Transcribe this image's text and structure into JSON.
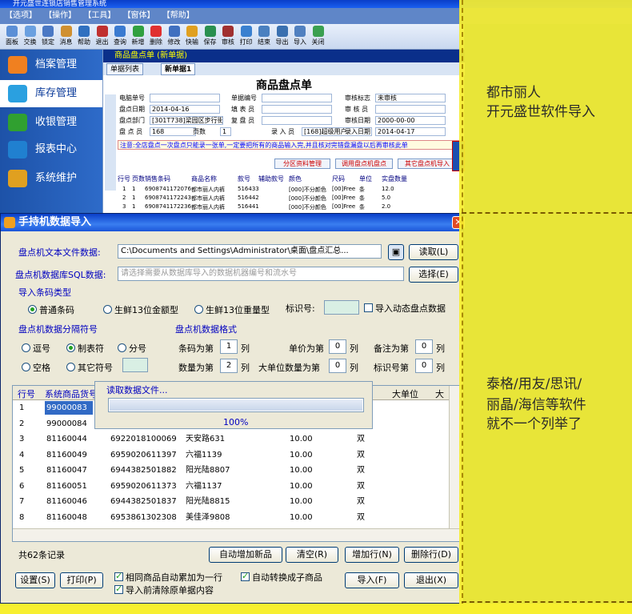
{
  "app": {
    "title": "开元盛世连锁店销售管理系统"
  },
  "menu": [
    "【选项】",
    "【操作】",
    "【工具】",
    "【窗体】",
    "【帮助】"
  ],
  "toolbar": [
    "面板",
    "交换",
    "锁定",
    "消息",
    "帮助",
    "退出",
    "查询",
    "新增",
    "删除",
    "修改",
    "快输",
    "保存",
    "审核",
    "打印",
    "结束",
    "导出",
    "导入",
    "关闭"
  ],
  "sidebar": [
    {
      "label": "档案管理",
      "color": "#f08020"
    },
    {
      "label": "库存管理",
      "color": "#2aa0e0"
    },
    {
      "label": "收银管理",
      "color": "#30a030"
    },
    {
      "label": "报表中心",
      "color": "#2080d0"
    },
    {
      "label": "系统维护",
      "color": "#e0a020"
    }
  ],
  "doc": {
    "header": "商品盘点单  (新单据)",
    "tabs": [
      "单据列表",
      "新单据1"
    ],
    "title": "商品盘点单",
    "fields": [
      {
        "label": "电脑单号",
        "value": ""
      },
      {
        "label": "单据编号",
        "value": ""
      },
      {
        "label": "审核标志",
        "value": "未审核"
      },
      {
        "label": "盘点日期",
        "value": "2014-04-16"
      },
      {
        "label": "填 表 员",
        "value": ""
      },
      {
        "label": "审 核 员",
        "value": ""
      },
      {
        "label": "盘点部门",
        "value": "[301T738]梁园区步行街店"
      },
      {
        "label": "复 盘 员",
        "value": ""
      },
      {
        "label": "审核日期",
        "value": "2000-00-00"
      },
      {
        "label": "盘 点 员",
        "value": "168"
      },
      {
        "label": "页数",
        "value": "1"
      },
      {
        "label": "录 入 员",
        "value": "[168]超级用户"
      },
      {
        "label": "录入日期",
        "value": "2014-04-17"
      }
    ],
    "notice": "注意:全店盘点一次盘点只能录一张单,一定要把所有的商品输入完,并且核对完错盘漏盘以后再审核此单",
    "buttons": [
      "分区资料管理",
      "调用盘点机盘点",
      "其它盘点机导入"
    ],
    "columns": [
      "行号",
      "页数",
      "销售条码",
      "商品名称",
      "款号",
      "辅助款号",
      "颜色",
      "尺码",
      "单位",
      "实盘数量"
    ],
    "rows": [
      [
        "1",
        "1",
        "6908741172076",
        "都市丽人内裤",
        "516433",
        "",
        "[000]不分颜色",
        "[00]Free",
        "条",
        "12.0"
      ],
      [
        "2",
        "1",
        "6908741172243",
        "都市丽人内裤",
        "516442",
        "",
        "[000]不分颜色",
        "[00]Free",
        "条",
        "5.0"
      ],
      [
        "3",
        "1",
        "6908741172236",
        "都市丽人内裤",
        "516441",
        "",
        "[000]不分颜色",
        "[00]Free",
        "条",
        "2.0"
      ]
    ]
  },
  "dialog": {
    "title": "手持机数据导入",
    "file_label": "盘点机文本文件数据:",
    "file_value": "C:\\Documents and Settings\\Administrator\\桌面\\盘点汇总...",
    "read_button": "读取(L)",
    "sql_label": "盘点机数据库SQL数据:",
    "sql_placeholder": "请选择需要从数据库导入的数据机器编号和流水号",
    "select_button": "选择(E)",
    "barcode_type_label": "导入条码类型",
    "barcode_types": [
      "普通条码",
      "生鲜13位金额型",
      "生鲜13位重量型"
    ],
    "marker_label": "标识号:",
    "dynamic_label": "导入动态盘点数据",
    "sep_label": "盘点机数据分隔符号",
    "seps": [
      "逗号",
      "制表符",
      "分号",
      "空格",
      "其它符号"
    ],
    "format_label": "盘点机数据格式",
    "format": {
      "barcode_col_label": "条码为第",
      "barcode_col": "1",
      "price_col_label": "单价为第",
      "price_col": "0",
      "note_col_label": "备注为第",
      "note_col": "0",
      "qty_col_label": "数量为第",
      "qty_col": "2",
      "bigunit_col_label": "大单位数量为第",
      "bigunit_col": "0",
      "marker_col_label": "标识号第",
      "marker_col": "0",
      "col_suffix": "列"
    },
    "grid_columns": [
      "行号",
      "系统商品货号",
      "",
      "",
      "",
      "大单位",
      "大"
    ],
    "grid_rows": [
      [
        "1",
        "99000083",
        "",
        "",
        "",
        ""
      ],
      [
        "2",
        "99000084",
        "",
        "",
        "",
        ""
      ],
      [
        "3",
        "81160044",
        "6922018100069",
        "天安路631",
        "10.00",
        "双"
      ],
      [
        "4",
        "81160049",
        "6959020611397",
        "六福1139",
        "10.00",
        "双"
      ],
      [
        "5",
        "81160047",
        "6944382501882",
        "阳光陆8807",
        "10.00",
        "双"
      ],
      [
        "6",
        "81160051",
        "6959020611373",
        "六福1137",
        "10.00",
        "双"
      ],
      [
        "7",
        "81160046",
        "6944382501837",
        "阳光陆8815",
        "10.00",
        "双"
      ],
      [
        "8",
        "81160048",
        "6953861302308",
        "美佳泽9808",
        "10.00",
        "双"
      ]
    ],
    "record_count": "共62条记录",
    "buttons": [
      "自动增加新品",
      "清空(R)",
      "增加行(N)",
      "删除行(D)"
    ],
    "bottom_buttons": [
      "设置(S)",
      "打印(P)",
      "导入(F)",
      "退出(X)"
    ],
    "checks": [
      "相同商品自动累加为一行",
      "自动转换成子商品",
      "导入前清除原单据内容"
    ],
    "progress": {
      "title": "读取数据文件...",
      "percent_text": "100%",
      "value": 1.0
    }
  },
  "overlay": {
    "line1": "都市丽人",
    "line2": "开元盛世软件导入",
    "line3": "泰格/用友/思讯/",
    "line4": "丽晶/海信等软件",
    "line5": "就不一个列举了"
  }
}
